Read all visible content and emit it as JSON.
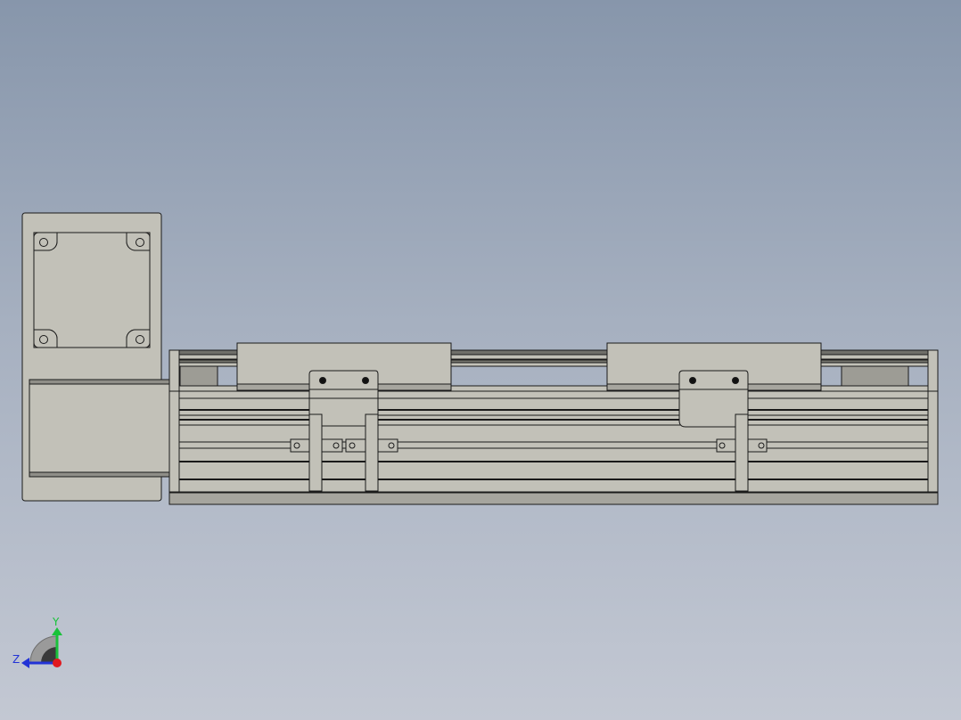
{
  "viewport": {
    "background_top": "#8796ab",
    "background_bottom": "#c3c8d3",
    "part_fill": "#c2c1b8",
    "part_dark": "#9d9c95",
    "edge_color": "#1a1a1a"
  },
  "model": {
    "components": [
      "motor",
      "motor-mount-plate",
      "coupling-housing",
      "linear-rail",
      "carriage",
      "carriage",
      "bracket",
      "bracket",
      "sensor",
      "sensor",
      "sensor"
    ]
  },
  "triad": {
    "y_label": "Y",
    "z_label": "Z",
    "y_color": "#19c23a",
    "z_color": "#2233d6",
    "x_color": "#e0181e"
  }
}
